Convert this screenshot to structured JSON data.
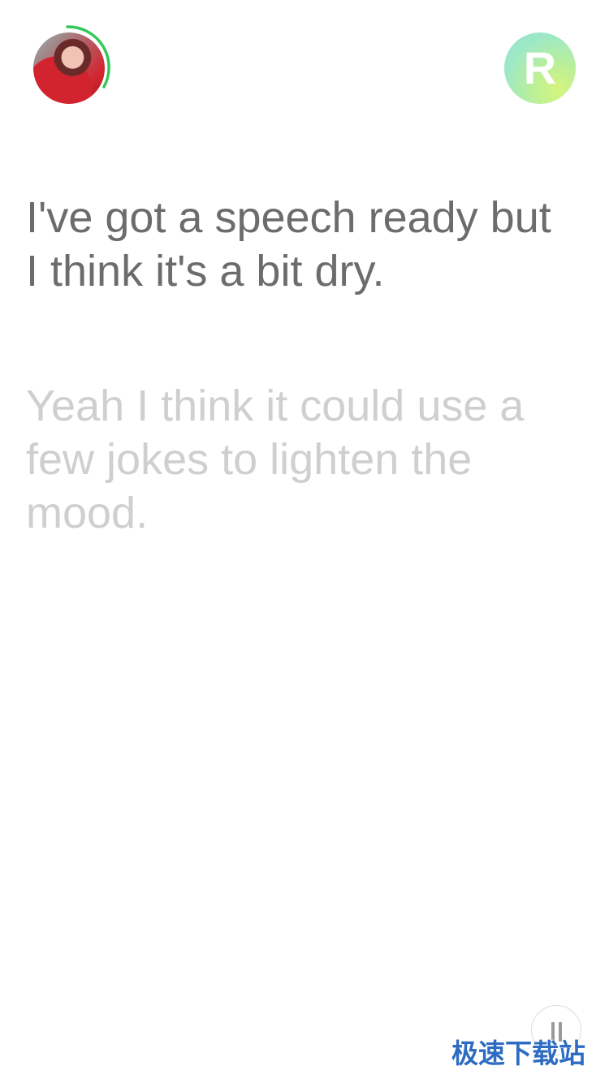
{
  "partner_avatar": {
    "icon": "partner-photo-avatar",
    "ring_color": "#34c759",
    "timer_progress": 0.25
  },
  "user_badge": {
    "letter": "R"
  },
  "conversation": {
    "lines": [
      {
        "text": "I've got a speech ready but\nI think it's a bit dry.",
        "color": "#6c6c6c"
      },
      {
        "text": "Yeah I think it could use a\nfew jokes to lighten the\nmood.",
        "color": "#cfcfcf"
      }
    ]
  },
  "controls": {
    "pause_icon": "pause-icon"
  },
  "watermark": {
    "text": "极速下载站",
    "color": "#2d6cc2"
  }
}
